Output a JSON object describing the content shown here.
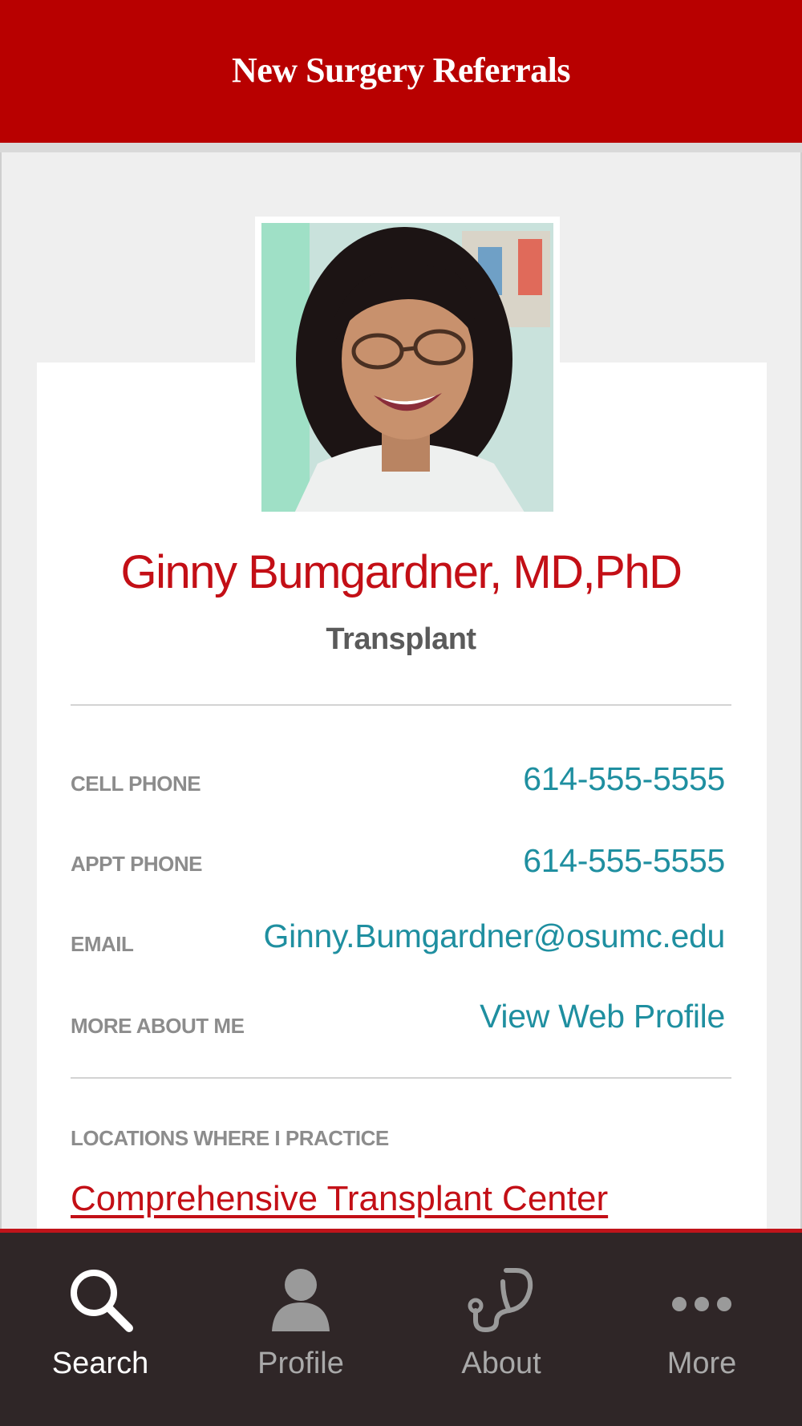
{
  "header": {
    "title": "New Surgery Referrals"
  },
  "doctor": {
    "name": "Ginny Bumgardner, MD,PhD",
    "specialty": "Transplant"
  },
  "contact": {
    "cell_label": "CELL PHONE",
    "cell_value": "614-555-5555",
    "appt_label": "APPT PHONE",
    "appt_value": "614-555-5555",
    "email_label": "EMAIL",
    "email_value": "Ginny.Bumgardner@osumc.edu",
    "more_label": "MORE ABOUT ME",
    "more_value": "View Web Profile"
  },
  "locations": {
    "label": "LOCATIONS WHERE I PRACTICE",
    "items": [
      "Comprehensive Transplant Center"
    ]
  },
  "tabbar": {
    "tabs": [
      {
        "label": "Search",
        "icon": "search-icon",
        "active": true
      },
      {
        "label": "Profile",
        "icon": "person-icon",
        "active": false
      },
      {
        "label": "About",
        "icon": "stethoscope-icon",
        "active": false
      },
      {
        "label": "More",
        "icon": "more-dots-icon",
        "active": false
      }
    ]
  },
  "colors": {
    "brand_red": "#b80000",
    "link_teal": "#1f8fa0",
    "tabbar_bg": "#2f2627"
  }
}
